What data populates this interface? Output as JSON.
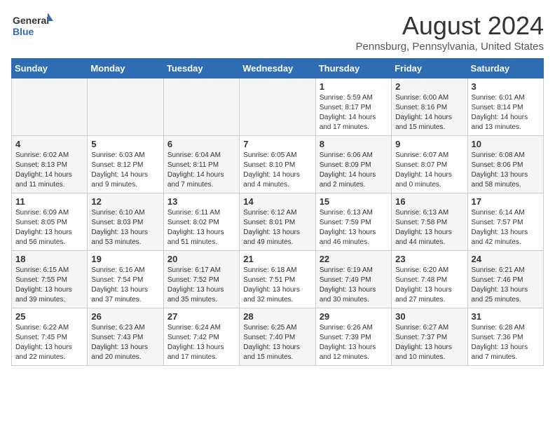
{
  "header": {
    "logo_general": "General",
    "logo_blue": "Blue",
    "month_year": "August 2024",
    "location": "Pennsburg, Pennsylvania, United States"
  },
  "weekdays": [
    "Sunday",
    "Monday",
    "Tuesday",
    "Wednesday",
    "Thursday",
    "Friday",
    "Saturday"
  ],
  "weeks": [
    [
      {
        "day": "",
        "detail": "",
        "shade": true
      },
      {
        "day": "",
        "detail": "",
        "shade": true
      },
      {
        "day": "",
        "detail": "",
        "shade": true
      },
      {
        "day": "",
        "detail": "",
        "shade": true
      },
      {
        "day": "1",
        "detail": "Sunrise: 5:59 AM\nSunset: 8:17 PM\nDaylight: 14 hours\nand 17 minutes.",
        "shade": false
      },
      {
        "day": "2",
        "detail": "Sunrise: 6:00 AM\nSunset: 8:16 PM\nDaylight: 14 hours\nand 15 minutes.",
        "shade": true
      },
      {
        "day": "3",
        "detail": "Sunrise: 6:01 AM\nSunset: 8:14 PM\nDaylight: 14 hours\nand 13 minutes.",
        "shade": false
      }
    ],
    [
      {
        "day": "4",
        "detail": "Sunrise: 6:02 AM\nSunset: 8:13 PM\nDaylight: 14 hours\nand 11 minutes.",
        "shade": true
      },
      {
        "day": "5",
        "detail": "Sunrise: 6:03 AM\nSunset: 8:12 PM\nDaylight: 14 hours\nand 9 minutes.",
        "shade": false
      },
      {
        "day": "6",
        "detail": "Sunrise: 6:04 AM\nSunset: 8:11 PM\nDaylight: 14 hours\nand 7 minutes.",
        "shade": true
      },
      {
        "day": "7",
        "detail": "Sunrise: 6:05 AM\nSunset: 8:10 PM\nDaylight: 14 hours\nand 4 minutes.",
        "shade": false
      },
      {
        "day": "8",
        "detail": "Sunrise: 6:06 AM\nSunset: 8:09 PM\nDaylight: 14 hours\nand 2 minutes.",
        "shade": true
      },
      {
        "day": "9",
        "detail": "Sunrise: 6:07 AM\nSunset: 8:07 PM\nDaylight: 14 hours\nand 0 minutes.",
        "shade": false
      },
      {
        "day": "10",
        "detail": "Sunrise: 6:08 AM\nSunset: 8:06 PM\nDaylight: 13 hours\nand 58 minutes.",
        "shade": true
      }
    ],
    [
      {
        "day": "11",
        "detail": "Sunrise: 6:09 AM\nSunset: 8:05 PM\nDaylight: 13 hours\nand 56 minutes.",
        "shade": false
      },
      {
        "day": "12",
        "detail": "Sunrise: 6:10 AM\nSunset: 8:03 PM\nDaylight: 13 hours\nand 53 minutes.",
        "shade": true
      },
      {
        "day": "13",
        "detail": "Sunrise: 6:11 AM\nSunset: 8:02 PM\nDaylight: 13 hours\nand 51 minutes.",
        "shade": false
      },
      {
        "day": "14",
        "detail": "Sunrise: 6:12 AM\nSunset: 8:01 PM\nDaylight: 13 hours\nand 49 minutes.",
        "shade": true
      },
      {
        "day": "15",
        "detail": "Sunrise: 6:13 AM\nSunset: 7:59 PM\nDaylight: 13 hours\nand 46 minutes.",
        "shade": false
      },
      {
        "day": "16",
        "detail": "Sunrise: 6:13 AM\nSunset: 7:58 PM\nDaylight: 13 hours\nand 44 minutes.",
        "shade": true
      },
      {
        "day": "17",
        "detail": "Sunrise: 6:14 AM\nSunset: 7:57 PM\nDaylight: 13 hours\nand 42 minutes.",
        "shade": false
      }
    ],
    [
      {
        "day": "18",
        "detail": "Sunrise: 6:15 AM\nSunset: 7:55 PM\nDaylight: 13 hours\nand 39 minutes.",
        "shade": true
      },
      {
        "day": "19",
        "detail": "Sunrise: 6:16 AM\nSunset: 7:54 PM\nDaylight: 13 hours\nand 37 minutes.",
        "shade": false
      },
      {
        "day": "20",
        "detail": "Sunrise: 6:17 AM\nSunset: 7:52 PM\nDaylight: 13 hours\nand 35 minutes.",
        "shade": true
      },
      {
        "day": "21",
        "detail": "Sunrise: 6:18 AM\nSunset: 7:51 PM\nDaylight: 13 hours\nand 32 minutes.",
        "shade": false
      },
      {
        "day": "22",
        "detail": "Sunrise: 6:19 AM\nSunset: 7:49 PM\nDaylight: 13 hours\nand 30 minutes.",
        "shade": true
      },
      {
        "day": "23",
        "detail": "Sunrise: 6:20 AM\nSunset: 7:48 PM\nDaylight: 13 hours\nand 27 minutes.",
        "shade": false
      },
      {
        "day": "24",
        "detail": "Sunrise: 6:21 AM\nSunset: 7:46 PM\nDaylight: 13 hours\nand 25 minutes.",
        "shade": true
      }
    ],
    [
      {
        "day": "25",
        "detail": "Sunrise: 6:22 AM\nSunset: 7:45 PM\nDaylight: 13 hours\nand 22 minutes.",
        "shade": false
      },
      {
        "day": "26",
        "detail": "Sunrise: 6:23 AM\nSunset: 7:43 PM\nDaylight: 13 hours\nand 20 minutes.",
        "shade": true
      },
      {
        "day": "27",
        "detail": "Sunrise: 6:24 AM\nSunset: 7:42 PM\nDaylight: 13 hours\nand 17 minutes.",
        "shade": false
      },
      {
        "day": "28",
        "detail": "Sunrise: 6:25 AM\nSunset: 7:40 PM\nDaylight: 13 hours\nand 15 minutes.",
        "shade": true
      },
      {
        "day": "29",
        "detail": "Sunrise: 6:26 AM\nSunset: 7:39 PM\nDaylight: 13 hours\nand 12 minutes.",
        "shade": false
      },
      {
        "day": "30",
        "detail": "Sunrise: 6:27 AM\nSunset: 7:37 PM\nDaylight: 13 hours\nand 10 minutes.",
        "shade": true
      },
      {
        "day": "31",
        "detail": "Sunrise: 6:28 AM\nSunset: 7:36 PM\nDaylight: 13 hours\nand 7 minutes.",
        "shade": false
      }
    ]
  ]
}
